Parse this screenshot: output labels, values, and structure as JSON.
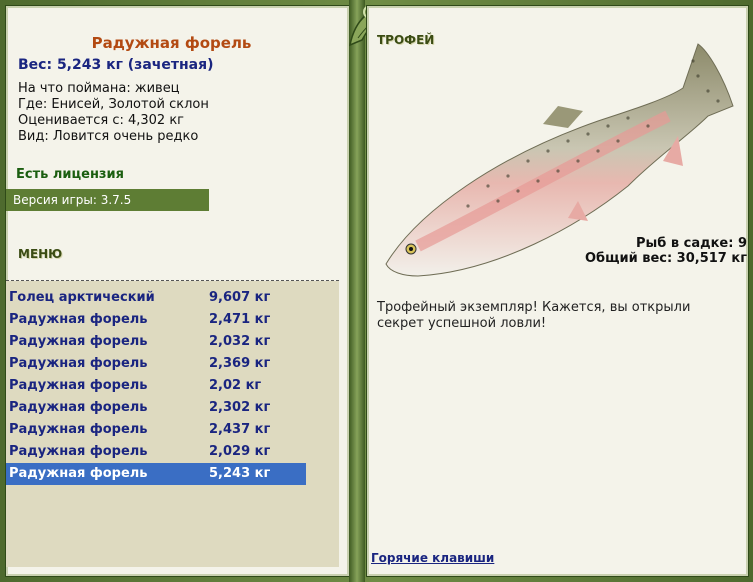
{
  "fish": {
    "name": "Радужная форель",
    "weight_line": "Вес: 5,243 кг (зачетная)",
    "bait": "На что поймана: живец",
    "location": "Где: Енисей, Золотой склон",
    "value": "Оценивается с: 4,302 кг",
    "view": "Вид: Ловится очень редко"
  },
  "license": "Есть лицензия",
  "version": "Версия игры: 3.7.5",
  "menu_label": "МЕНЮ",
  "cage": {
    "count": "Рыб в садке: 9",
    "total": "Общий вес: 30,517 кг"
  },
  "catch_list": [
    {
      "name": "Голец арктический",
      "weight": "9,607 кг"
    },
    {
      "name": "Радужная форель",
      "weight": "2,471 кг"
    },
    {
      "name": "Радужная форель",
      "weight": "2,032 кг"
    },
    {
      "name": "Радужная форель",
      "weight": "2,369 кг"
    },
    {
      "name": "Радужная форель",
      "weight": "2,02 кг"
    },
    {
      "name": "Радужная форель",
      "weight": "2,302 кг"
    },
    {
      "name": "Радужная форель",
      "weight": "2,437 кг"
    },
    {
      "name": "Радужная форель",
      "weight": "2,029 кг"
    },
    {
      "name": "Радужная форель",
      "weight": "5,243 кг"
    }
  ],
  "selected_index": 8,
  "trophy": {
    "title": "ТРОФЕЙ",
    "description": "Трофейный экземпляр! Кажется, вы открыли секрет успешной ловли!"
  },
  "hotkeys_label": "Горячие клавиши",
  "colors": {
    "frame": "#5f7a3a",
    "panel": "#f4f3ea",
    "list_bg": "#dedac0",
    "selected": "#3a6ec4",
    "title": "#b34a12",
    "link": "#1a2580"
  },
  "icons": [
    "leaf-ornament-icon",
    "rainbow-trout-image"
  ]
}
